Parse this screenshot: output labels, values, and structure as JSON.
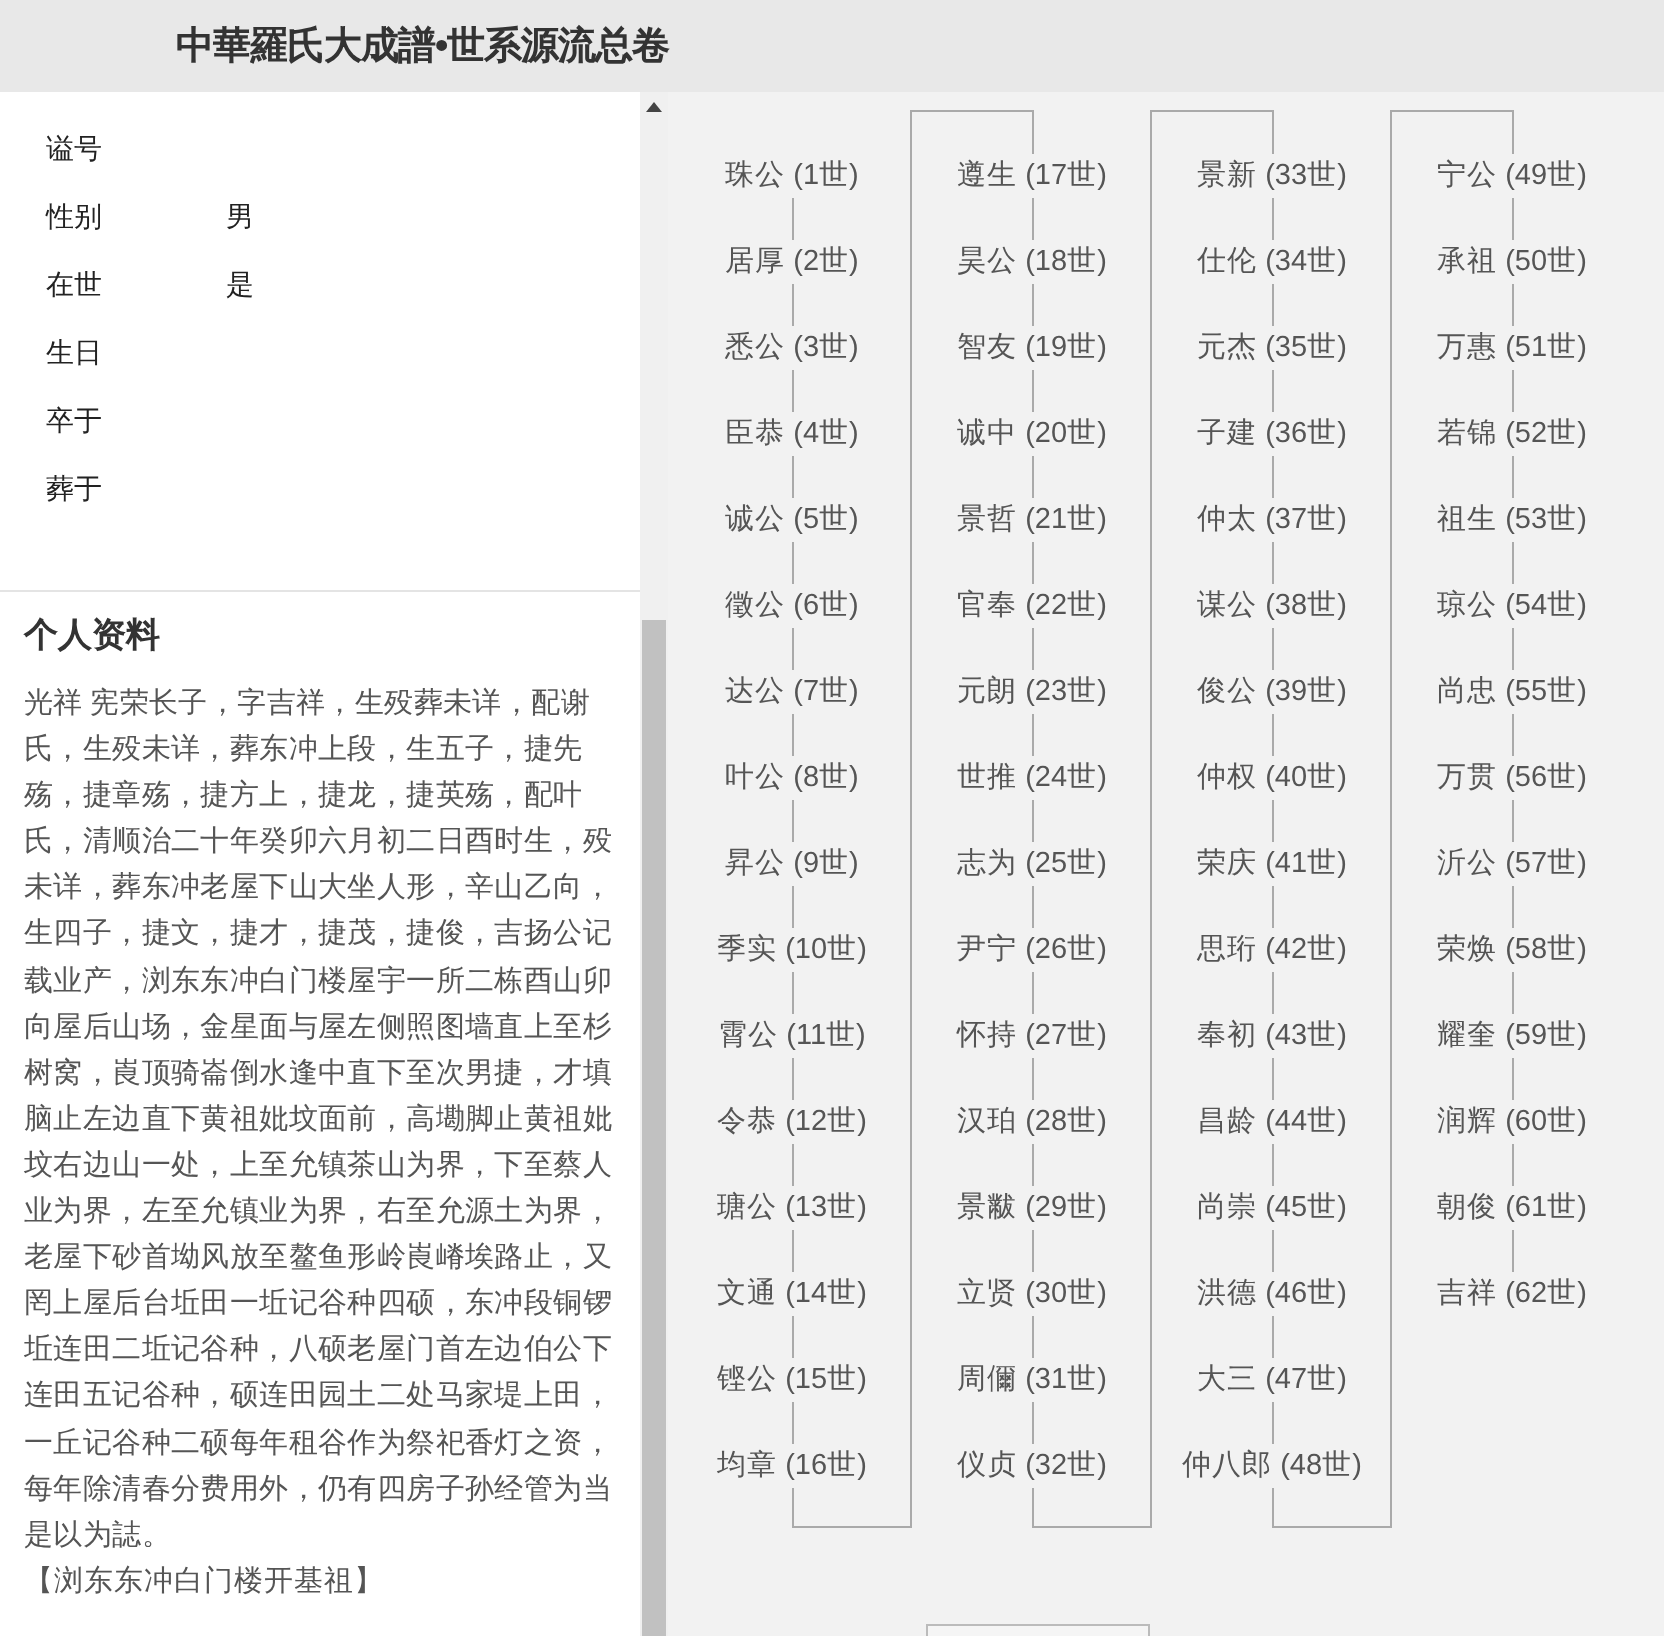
{
  "header": {
    "title": "中華羅氏大成譜•世系源流总卷"
  },
  "fields": [
    {
      "label": "谥号"
    },
    {
      "label": "性别",
      "value": "男"
    },
    {
      "label": "在世",
      "value": "是"
    },
    {
      "label": "生日"
    },
    {
      "label": "卒于"
    },
    {
      "label": "葬于"
    }
  ],
  "profile": {
    "heading": "个人资料",
    "text": "光祥 宪荣长子，字吉祥，生殁葬未详，配谢氏，生殁未详，葬东冲上段，生五子，捷先殇，捷章殇，捷方上，捷龙，捷英殇，配叶氏，清顺治二十年癸卯六月初二日酉时生，殁未详，葬东冲老屋下山大坐人形，辛山乙向，生四子，捷文，捷才，捷茂，捷俊，吉扬公记载业产，浏东东冲白门楼屋宇一所二栋酉山卯向屋后山场，金星面与屋左侧照图墙直上至杉树窝，崀顶骑崙倒水逢中直下至次男捷，才填脑止左边直下黄祖妣坟面前，高墈脚止黄祖妣坟右边山一处，上至允镇茶山为界，下至蔡人业为界，左至允镇业为界，右至允源土为界，老屋下砂首坳风放至鳌鱼形岭崀嵴埃路止，又罔上屋后台坵田一坵记谷种四硕，东冲段铜锣坵连田二坵记谷种，八硕老屋门首左边伯公下连田五记谷种，硕连田园土二处马家堤上田，一丘记谷种二硕每年租谷作为祭祀香灯之资，每年除清春分费用外，仍有四房子孙经管为当是以为誌。",
    "note": "【浏东东冲白门楼开基祖】"
  },
  "lineage": {
    "columns": [
      [
        "珠公 (1世)",
        "居厚 (2世)",
        "悉公 (3世)",
        "臣恭 (4世)",
        "诚公 (5世)",
        "徵公 (6世)",
        "达公 (7世)",
        "叶公 (8世)",
        "昇公 (9世)",
        "季实 (10世)",
        "霄公 (11世)",
        "令恭 (12世)",
        "瑭公 (13世)",
        "文通 (14世)",
        "铿公 (15世)",
        "均章 (16世)"
      ],
      [
        "遵生 (17世)",
        "昊公 (18世)",
        "智友 (19世)",
        "诚中 (20世)",
        "景哲 (21世)",
        "官奉 (22世)",
        "元朗 (23世)",
        "世推 (24世)",
        "志为 (25世)",
        "尹宁 (26世)",
        "怀持 (27世)",
        "汉珀 (28世)",
        "景黻 (29世)",
        "立贤 (30世)",
        "周儞 (31世)",
        "仪贞 (32世)"
      ],
      [
        "景新 (33世)",
        "仕伦 (34世)",
        "元杰 (35世)",
        "子建 (36世)",
        "仲太 (37世)",
        "谋公 (38世)",
        "俊公 (39世)",
        "仲权 (40世)",
        "荣庆 (41世)",
        "思珩 (42世)",
        "奉初 (43世)",
        "昌龄 (44世)",
        "尚崇 (45世)",
        "洪德 (46世)",
        "大三 (47世)",
        "仲八郎 (48世)"
      ],
      [
        "宁公 (49世)",
        "承祖 (50世)",
        "万惠 (51世)",
        "若锦 (52世)",
        "祖生 (53世)",
        "琼公 (54世)",
        "尚忠 (55世)",
        "万贯 (56世)",
        "沂公 (57世)",
        "荣焕 (58世)",
        "耀奎 (59世)",
        "润辉 (60世)",
        "朝俊 (61世)",
        "吉祥 (62世)"
      ]
    ]
  }
}
